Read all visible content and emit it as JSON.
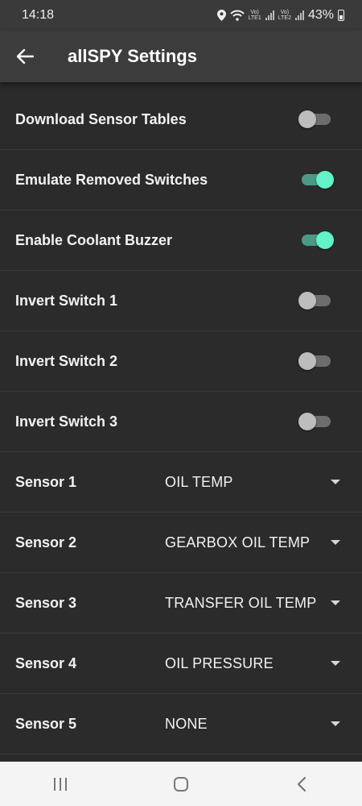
{
  "status_bar": {
    "time": "14:18",
    "net1": {
      "top": "Vo)",
      "bottom": "LTE1"
    },
    "net2": {
      "top": "Vo)",
      "bottom": "LTE2"
    },
    "battery_text": "43%",
    "icons": [
      "location-icon",
      "wifi-icon",
      "signal-icon",
      "battery-icon"
    ]
  },
  "app_bar": {
    "title": "allSPY Settings",
    "back_icon": "arrow-left-icon"
  },
  "switches": [
    {
      "label": "Download Sensor Tables",
      "on": false
    },
    {
      "label": "Emulate Removed Switches",
      "on": true
    },
    {
      "label": "Enable Coolant Buzzer",
      "on": true
    },
    {
      "label": "Invert Switch 1",
      "on": false
    },
    {
      "label": "Invert Switch 2",
      "on": false
    },
    {
      "label": "Invert Switch 3",
      "on": false
    }
  ],
  "sensors": [
    {
      "label": "Sensor 1",
      "value": "OIL TEMP"
    },
    {
      "label": "Sensor 2",
      "value": "GEARBOX OIL TEMP"
    },
    {
      "label": "Sensor 3",
      "value": "TRANSFER OIL TEMP"
    },
    {
      "label": "Sensor 4",
      "value": "OIL PRESSURE"
    },
    {
      "label": "Sensor 5",
      "value": "NONE"
    }
  ],
  "nav_bar": {
    "icons": [
      "recent-apps-icon",
      "home-icon",
      "back-icon"
    ]
  },
  "colors": {
    "background": "#2b2b2b",
    "app_bar": "#3c3c3c",
    "switch_on_thumb": "#62f3c8",
    "switch_on_track": "#4c9a85",
    "switch_off_thumb": "#bdbdbd",
    "switch_off_track": "#6d6d6d"
  }
}
